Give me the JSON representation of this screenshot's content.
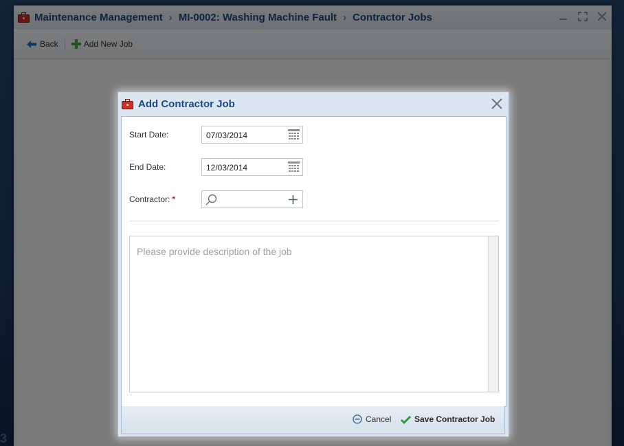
{
  "window": {
    "breadcrumb": [
      "Maintenance Management",
      "MI-0002: Washing Machine Fault",
      "Contractor Jobs"
    ],
    "separator": "›"
  },
  "toolbar": {
    "back_label": "Back",
    "add_new_job_label": "Add New Job"
  },
  "dialog": {
    "title": "Add Contractor Job",
    "start_date_label": "Start Date:",
    "start_date_value": "07/03/2014",
    "end_date_label": "End Date:",
    "end_date_value": "12/03/2014",
    "contractor_label": "Contractor:",
    "required_marker": "*",
    "description_placeholder": "Please provide description of the job",
    "cancel_label": "Cancel",
    "save_label": "Save Contractor Job"
  },
  "desktop": {
    "corner_glyph": "3"
  },
  "icons": {
    "app": "toolbox-icon",
    "back": "arrow-left-icon",
    "add": "plus-icon",
    "calendar": "calendar-icon",
    "search": "magnifier-icon",
    "cancel": "minus-circle-icon",
    "save": "checkmark-icon"
  },
  "colors": {
    "title_text": "#1b4a86",
    "required": "#d11b1b",
    "save_check": "#2f9a46"
  }
}
